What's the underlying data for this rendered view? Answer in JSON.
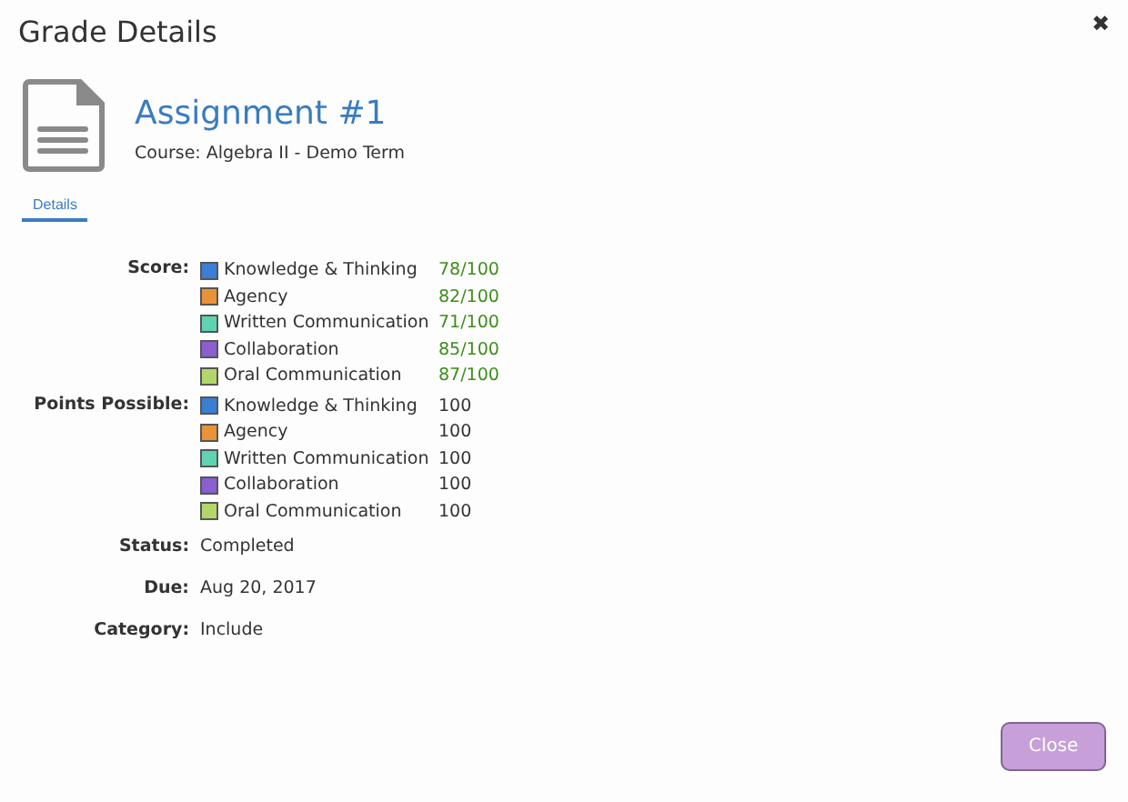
{
  "window": {
    "title": "Grade Details",
    "close": "✖"
  },
  "assignment": {
    "title": "Assignment #1",
    "course": "Course: Algebra II - Demo Term"
  },
  "tabs": [
    {
      "label": "Details",
      "selected": true
    }
  ],
  "score": {
    "label": "Score:",
    "items": [
      {
        "name": "Knowledge & Thinking",
        "color": "#3b7fd4",
        "value": "78/100"
      },
      {
        "name": "Agency",
        "color": "#e8923a",
        "value": "82/100"
      },
      {
        "name": "Written Communication",
        "color": "#5fd3b0",
        "value": "71/100"
      },
      {
        "name": "Collaboration",
        "color": "#8a5fd0",
        "value": "85/100"
      },
      {
        "name": "Oral Communication",
        "color": "#b3d66a",
        "value": "87/100"
      }
    ]
  },
  "points_possible": {
    "label": "Points Possible:",
    "items": [
      {
        "name": "Knowledge & Thinking",
        "color": "#3b7fd4",
        "value": "100"
      },
      {
        "name": "Agency",
        "color": "#e8923a",
        "value": "100"
      },
      {
        "name": "Written Communication",
        "color": "#5fd3b0",
        "value": "100"
      },
      {
        "name": "Collaboration",
        "color": "#8a5fd0",
        "value": "100"
      },
      {
        "name": "Oral Communication",
        "color": "#b3d66a",
        "value": "100"
      }
    ]
  },
  "fields": [
    {
      "label": "Status:",
      "value": "Completed"
    },
    {
      "label": "Due:",
      "value": "Aug 20, 2017"
    },
    {
      "label": "Category:",
      "value": "Include"
    }
  ],
  "buttons": [
    {
      "label": "Close"
    }
  ]
}
